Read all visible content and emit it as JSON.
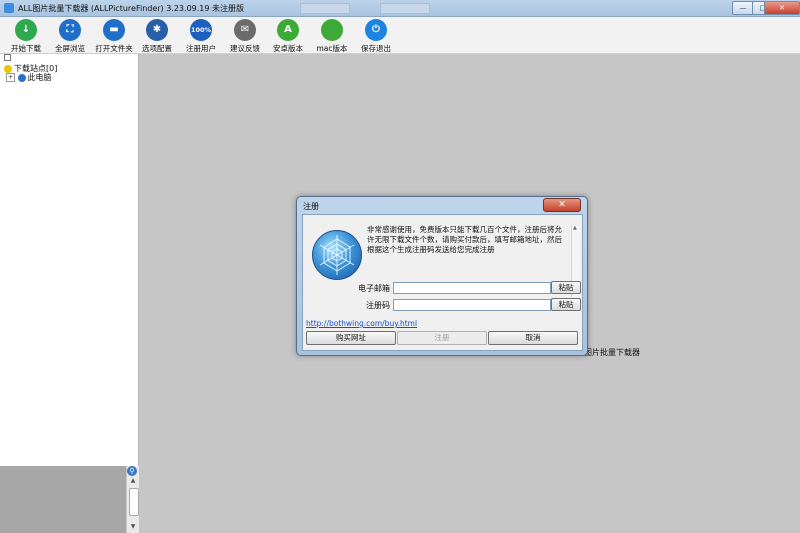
{
  "window": {
    "title": "ALL图片批量下载器 (ALLPictureFinder) 3.23.09.19 未注册版",
    "buttons": {
      "minimize": "—",
      "maximize": "□",
      "close": "✕"
    }
  },
  "toolbar": {
    "items": [
      {
        "label": "开始下载",
        "icon": "download-icon",
        "glyph": "↓",
        "color": "#2fa84f"
      },
      {
        "label": "全屏浏览",
        "icon": "fullscreen-icon",
        "glyph": "⛶",
        "color": "#1f6fc9"
      },
      {
        "label": "打开文件夹",
        "icon": "folder-icon",
        "glyph": "▬",
        "color": "#1f6fc9"
      },
      {
        "label": "选项配置",
        "icon": "gear-icon",
        "glyph": "✱",
        "color": "#2a5fa8"
      },
      {
        "label": "注册用户",
        "icon": "register-icon",
        "glyph": "100%",
        "color": "#1c5fbf"
      },
      {
        "label": "建议反馈",
        "icon": "feedback-icon",
        "glyph": "✉",
        "color": "#6b6b6b"
      },
      {
        "label": "安卓版本",
        "icon": "android-icon",
        "glyph": "A",
        "color": "#3da936"
      },
      {
        "label": "mac版本",
        "icon": "apple-icon",
        "glyph": "",
        "color": "#3da936"
      },
      {
        "label": "保存退出",
        "icon": "power-icon",
        "glyph": "⏻",
        "color": "#1c83e0"
      }
    ]
  },
  "tree": {
    "root_label": "下载站点[0]",
    "child_label": "此电脑",
    "expander": "+"
  },
  "main": {
    "caption": "图片批量下载器"
  },
  "dialog": {
    "title": "注册",
    "close": "✕",
    "message": "非常感谢使用，免费版本只能下载几百个文件，注册后将允许无限下载文件个数，请购买付款后，填写邮箱地址，然后根据这个生成注册码发送给您完成注册",
    "email_label": "电子邮箱",
    "email_value": "",
    "code_label": "注册码",
    "code_value": "",
    "paste_label": "粘贴",
    "buy_link": "http://bothwing.com/buy.html",
    "buy_button": "购买网址",
    "register_button": "注册",
    "cancel_button": "取消"
  }
}
